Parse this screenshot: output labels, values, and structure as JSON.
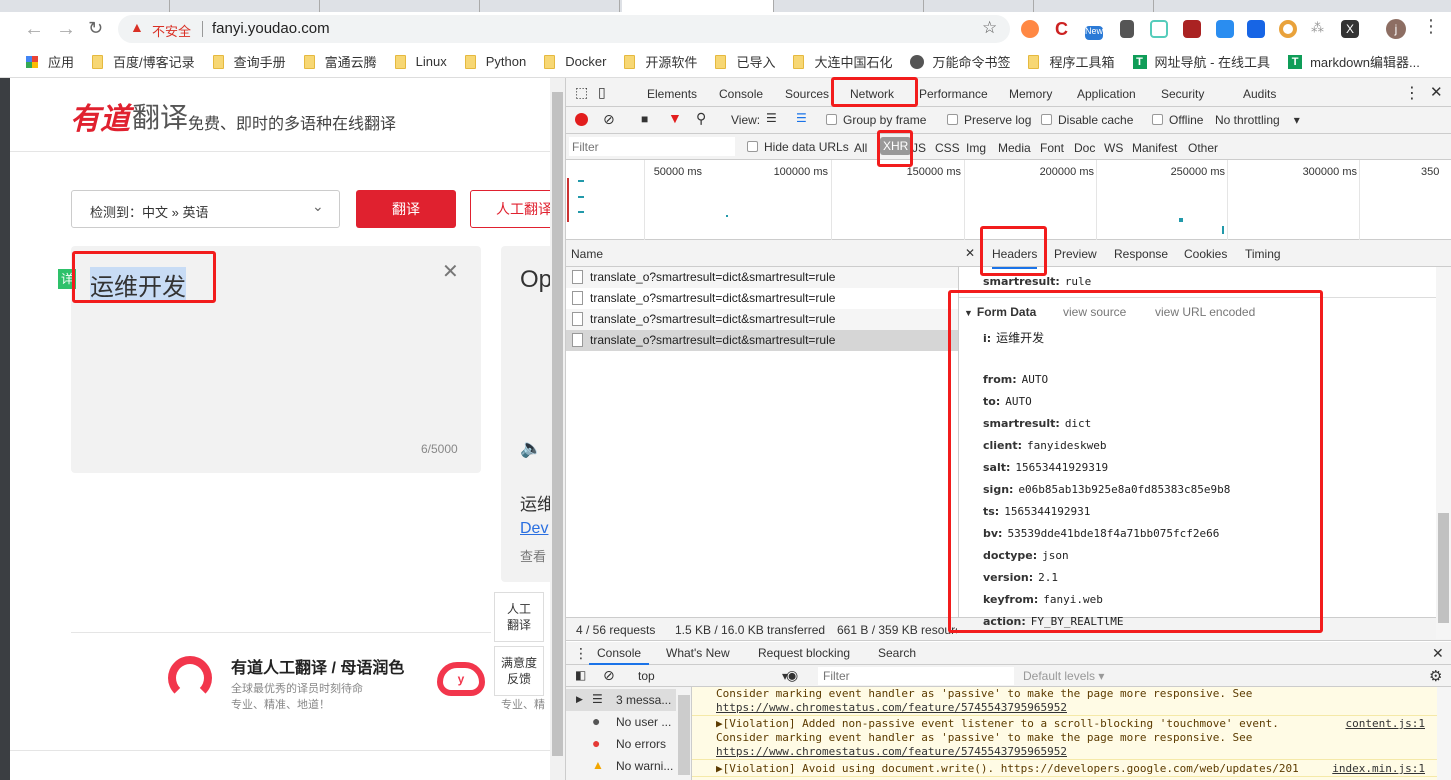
{
  "browser": {
    "insecure_label": "不安全",
    "url": "fanyi.youdao.com",
    "avatar_letter": "j",
    "new_badge": "New",
    "bookmarks": [
      "应用",
      "百度/博客记录",
      "查询手册",
      "富通云腾",
      "Linux",
      "Python",
      "Docker",
      "开源软件",
      "已导入",
      "大连中国石化",
      "万能命令书签",
      "程序工具箱",
      "网址导航 - 在线工具",
      "markdown编辑器..."
    ],
    "more": "»"
  },
  "page": {
    "logo_red": "有道",
    "logo_gray": "翻译",
    "slogan": "免费、即时的多语种在线翻译",
    "lang_select": "检测到：中文 » 英语",
    "translate_btn": "翻译",
    "human_btn": "人工翻译",
    "input_text": "运维开发",
    "detail_tag": "详",
    "char_count": "6/5000",
    "output_text": "Op",
    "result_word": "运维",
    "result_link": "Dev",
    "result_more": "查看",
    "side_btn1": "人工\n翻译",
    "side_btn2": "满意度\n反馈",
    "promo_title": "有道人工翻译 / 母语润色",
    "promo_sub1": "全球最优秀的译员时刻待命",
    "promo_sub2": "专业、精准、地道！",
    "promo_sub3": "专业、精"
  },
  "devtools": {
    "tabs": [
      "Elements",
      "Console",
      "Sources",
      "Network",
      "Performance",
      "Memory",
      "Application",
      "Security",
      "Audits"
    ],
    "active_tab": "Network",
    "toolbar": {
      "view": "View:",
      "group_by_frame": "Group by frame",
      "preserve_log": "Preserve log",
      "disable_cache": "Disable cache",
      "offline": "Offline",
      "throttling": "No throttling"
    },
    "filter_placeholder": "Filter",
    "hide_data_urls": "Hide data URLs",
    "types": [
      "All",
      "XHR",
      "JS",
      "CSS",
      "Img",
      "Media",
      "Font",
      "Doc",
      "WS",
      "Manifest",
      "Other"
    ],
    "active_type": "XHR",
    "timeline": [
      "50000 ms",
      "100000 ms",
      "150000 ms",
      "200000 ms",
      "250000 ms",
      "300000 ms",
      "350"
    ],
    "name_header": "Name",
    "requests": [
      "translate_o?smartresult=dict&smartresult=rule",
      "translate_o?smartresult=dict&smartresult=rule",
      "translate_o?smartresult=dict&smartresult=rule",
      "translate_o?smartresult=dict&smartresult=rule"
    ],
    "detail_tabs": [
      "Headers",
      "Preview",
      "Response",
      "Cookies",
      "Timing"
    ],
    "prev_param": {
      "k": "smartresult:",
      "v": "rule"
    },
    "form_data": {
      "title": "Form Data",
      "view_source": "view source",
      "view_url_encoded": "view URL encoded",
      "fields": [
        {
          "k": "i:",
          "v": "运维开发"
        },
        {
          "k": "from:",
          "v": "AUTO"
        },
        {
          "k": "to:",
          "v": "AUTO"
        },
        {
          "k": "smartresult:",
          "v": "dict"
        },
        {
          "k": "client:",
          "v": "fanyideskweb"
        },
        {
          "k": "salt:",
          "v": "15653441929319"
        },
        {
          "k": "sign:",
          "v": "e06b85ab13b925e8a0fd85383c85e9b8"
        },
        {
          "k": "ts:",
          "v": "1565344192931"
        },
        {
          "k": "bv:",
          "v": "53539dde41bde18f4a71bb075fcf2e66"
        },
        {
          "k": "doctype:",
          "v": "json"
        },
        {
          "k": "version:",
          "v": "2.1"
        },
        {
          "k": "keyfrom:",
          "v": "fanyi.web"
        },
        {
          "k": "action:",
          "v": "FY_BY_REALTlME"
        }
      ]
    },
    "status": {
      "requests": "4 / 56 requests",
      "transferred": "1.5 KB / 16.0 KB transferred",
      "resources": "661 B / 359 KB resources"
    },
    "drawer_tabs": [
      "Console",
      "What's New",
      "Request blocking",
      "Search"
    ],
    "console": {
      "context": "top",
      "filter_placeholder": "Filter",
      "levels": "Default levels ▾",
      "sidebar": [
        "3 messa...",
        "No user ...",
        "No errors",
        "No warni..."
      ],
      "messages": [
        {
          "text": "Consider marking event handler as 'passive' to make the page more responsive. See ",
          "link": "https://www.chromestatus.com/feature/5745543795965952",
          "src": ""
        },
        {
          "text": "▶[Violation] Added non-passive event listener to a scroll-blocking 'touchmove' event.\nConsider marking event handler as 'passive' to make the page more responsive. See ",
          "link": "https://www.chromestatus.com/feature/5745543795965952",
          "src": "content.js:1"
        },
        {
          "text": "▶[Violation] Avoid using document.write(). https://developers.google.com/web/updates/201",
          "link": "",
          "src": "index.min.js:1"
        }
      ]
    }
  }
}
